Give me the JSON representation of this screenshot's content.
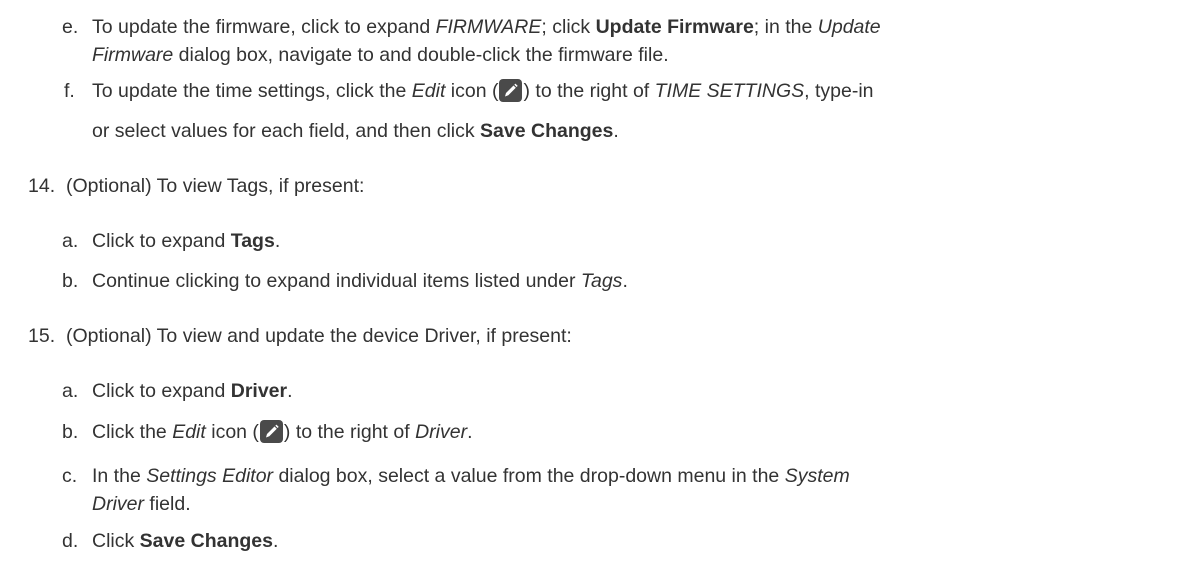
{
  "steps": {
    "s13e": {
      "marker": "e.",
      "l1": {
        "t1": "To update the firmware, click to expand ",
        "t2": "FIRMWARE",
        "t3": "; click ",
        "t4": "Update Firmware",
        "t5": "; in the ",
        "t6": "Update"
      },
      "l2": {
        "t1": "Firmware",
        "t2": " dialog box, navigate to and double-click the firmware file."
      }
    },
    "s13f": {
      "marker": "f.",
      "l1": {
        "t1": "To update the time settings, click the ",
        "t2": "Edit",
        "t3": " icon (",
        "t4": ") to the right of ",
        "t5": "TIME SETTINGS",
        "t6": ", type-in"
      },
      "l2": {
        "t1": "or select values for each field, and then click ",
        "t2": "Save Changes",
        "t3": "."
      }
    },
    "s14": {
      "marker": "14.",
      "text": "(Optional) To view Tags, if present:",
      "a": {
        "marker": "a.",
        "t1": "Click to expand ",
        "t2": "Tags",
        "t3": "."
      },
      "b": {
        "marker": "b.",
        "t1": "Continue clicking to expand individual items listed under ",
        "t2": "Tags",
        "t3": "."
      }
    },
    "s15": {
      "marker": "15.",
      "text": "(Optional) To view and update the device Driver, if present:",
      "a": {
        "marker": "a.",
        "t1": "Click to expand ",
        "t2": "Driver",
        "t3": "."
      },
      "b": {
        "marker": "b.",
        "t1": "Click the ",
        "t2": "Edit",
        "t3": " icon (",
        "t4": ") to the right of ",
        "t5": "Driver",
        "t6": "."
      },
      "c": {
        "marker": "c.",
        "l1": {
          "t1": "In the ",
          "t2": "Settings Editor",
          "t3": " dialog box, select a value from the drop-down menu in the ",
          "t4": "System"
        },
        "l2": {
          "t1": "Driver",
          "t2": " field."
        }
      },
      "d": {
        "marker": "d.",
        "t1": "Click ",
        "t2": "Save Changes",
        "t3": "."
      }
    }
  },
  "icons": {
    "edit_icon": "pencil-icon",
    "edit_icon_bg": "#4a4a4a",
    "edit_icon_fg": "#ffffff"
  }
}
